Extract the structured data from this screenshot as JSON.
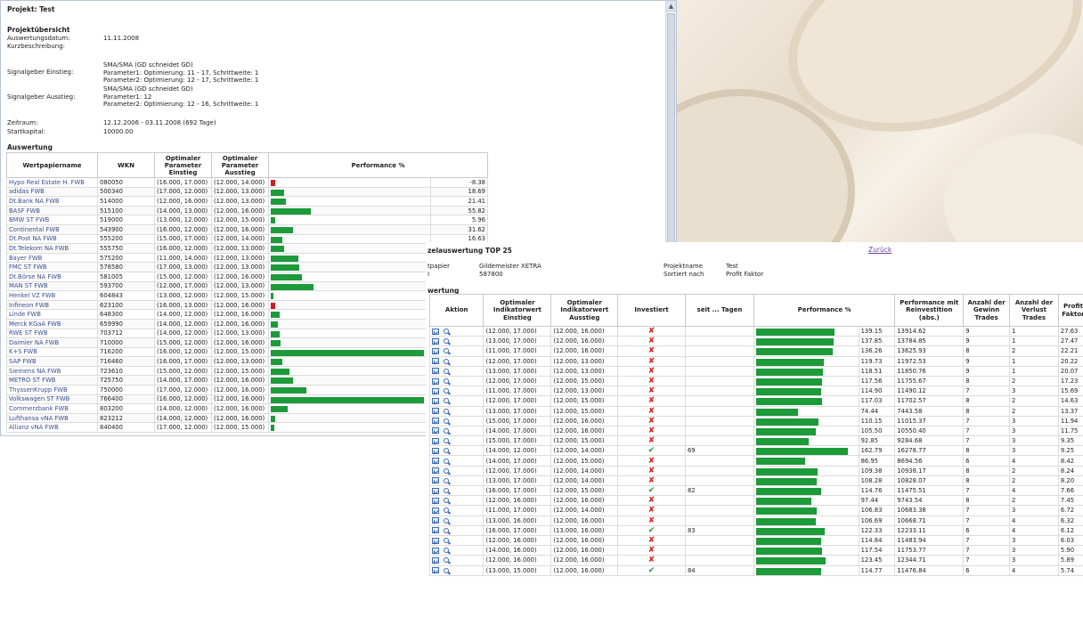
{
  "window1": {
    "title": "Projekt: Test",
    "overview_heading": "Projektübersicht",
    "fields": [
      {
        "label": "Auswertungsdatum:",
        "value": [
          "11.11.2008"
        ]
      },
      {
        "label": "Kurzbeschreibung:",
        "value": [
          ""
        ]
      },
      {
        "label": "Signalgeber Einstieg:",
        "value": [
          "SMA/SMA (GD schneidet GD)",
          "Parameter1: Optimierung: 11 - 17, Schrittweite: 1",
          "Parameter2: Optimierung: 12 - 17, Schrittweite: 1"
        ]
      },
      {
        "label": "Signalgeber Ausstieg:",
        "value": [
          "SMA/SMA (GD schneidet GD)",
          "Parameter1: 12",
          "Parameter2: Optimierung: 12 - 16, Schrittweite: 1"
        ]
      },
      {
        "label": "Zeitraum:",
        "value": [
          "12.12.2006 - 03.11.2008 (692 Tage)"
        ]
      },
      {
        "label": "Startkapital:",
        "value": [
          "10000.00"
        ]
      }
    ],
    "eval_heading": "Auswertung",
    "headers": [
      "Wertpapiername",
      "WKN",
      "Optimaler Parameter Einstieg",
      "Optimaler Parameter Ausstieg",
      "Performance %"
    ],
    "rows": [
      {
        "name": "Hypo Real Estate H. FWB",
        "wkn": "080050",
        "p1": "(16.000, 17.000)",
        "p2": "(12.000, 14.000)",
        "perf": "-8.38",
        "v": -8.38
      },
      {
        "name": "adidas FWB",
        "wkn": "500340",
        "p1": "(17.000, 12.000)",
        "p2": "(12.000, 13.000)",
        "perf": "18.69",
        "v": 18.69
      },
      {
        "name": "Dt.Bank NA FWB",
        "wkn": "514000",
        "p1": "(12.000, 16.000)",
        "p2": "(12.000, 13.000)",
        "perf": "21.41",
        "v": 21.41
      },
      {
        "name": "BASF FWB",
        "wkn": "515100",
        "p1": "(14.000, 13.000)",
        "p2": "(12.000, 16.000)",
        "perf": "55.82",
        "v": 55.82
      },
      {
        "name": "BMW ST FWB",
        "wkn": "519000",
        "p1": "(13.000, 12.000)",
        "p2": "(12.000, 15.000)",
        "perf": "5.96",
        "v": 5.96
      },
      {
        "name": "Continental FWB",
        "wkn": "543900",
        "p1": "(16.000, 12.000)",
        "p2": "(12.000, 16.000)",
        "perf": "31.62",
        "v": 31.62
      },
      {
        "name": "Dt.Post NA FWB",
        "wkn": "555200",
        "p1": "(15.000, 17.000)",
        "p2": "(12.000, 14.000)",
        "perf": "16.63",
        "v": 16.63
      },
      {
        "name": "Dt.Telekom NA FWB",
        "wkn": "555750",
        "p1": "(16.000, 12.000)",
        "p2": "(12.000, 13.000)",
        "perf": "",
        "v": 18.5
      },
      {
        "name": "Bayer FWB",
        "wkn": "575200",
        "p1": "(11.000, 14.000)",
        "p2": "(12.000, 13.000)",
        "perf": "",
        "v": 39.0
      },
      {
        "name": "FMC ST FWB",
        "wkn": "578580",
        "p1": "(17.000, 13.000)",
        "p2": "(12.000, 13.000)",
        "perf": "",
        "v": 40.0
      },
      {
        "name": "Dt.Börse NA FWB",
        "wkn": "581005",
        "p1": "(15.000, 12.000)",
        "p2": "(12.000, 16.000)",
        "perf": "",
        "v": 43.0
      },
      {
        "name": "MAN ST FWB",
        "wkn": "593700",
        "p1": "(12.000, 17.000)",
        "p2": "(12.000, 13.000)",
        "perf": "",
        "v": 60.0
      },
      {
        "name": "Henkel VZ FWB",
        "wkn": "604843",
        "p1": "(13.000, 12.000)",
        "p2": "(12.000, 15.000)",
        "perf": "",
        "v": 4.0
      },
      {
        "name": "Infineon FWB",
        "wkn": "623100",
        "p1": "(16.000, 13.000)",
        "p2": "(12.000, 16.000)",
        "perf": "",
        "v": -8.0
      },
      {
        "name": "Linde FWB",
        "wkn": "648300",
        "p1": "(14.000, 12.000)",
        "p2": "(12.000, 16.000)",
        "perf": "",
        "v": 13.0
      },
      {
        "name": "Merck KGaA FWB",
        "wkn": "659990",
        "p1": "(14.000, 12.000)",
        "p2": "(12.000, 16.000)",
        "perf": "",
        "v": 10.0
      },
      {
        "name": "RWE ST FWB",
        "wkn": "703712",
        "p1": "(14.000, 12.000)",
        "p2": "(12.000, 13.000)",
        "perf": "",
        "v": 13.0
      },
      {
        "name": "Daimler NA FWB",
        "wkn": "710000",
        "p1": "(15.000, 12.000)",
        "p2": "(12.000, 16.000)",
        "perf": "",
        "v": 14.0
      },
      {
        "name": "K+S FWB",
        "wkn": "716200",
        "p1": "(16.000, 12.000)",
        "p2": "(12.000, 15.000)",
        "perf": "",
        "v": 200.0
      },
      {
        "name": "SAP FWB",
        "wkn": "716460",
        "p1": "(16.000, 17.000)",
        "p2": "(12.000, 13.000)",
        "perf": "",
        "v": 16.0
      },
      {
        "name": "Siemens NA FWB",
        "wkn": "723610",
        "p1": "(15.000, 12.000)",
        "p2": "(12.000, 15.000)",
        "perf": "",
        "v": 26.0
      },
      {
        "name": "METRO ST FWB",
        "wkn": "725750",
        "p1": "(14.000, 17.000)",
        "p2": "(12.000, 16.000)",
        "perf": "",
        "v": 31.0
      },
      {
        "name": "ThyssenKrupp FWB",
        "wkn": "750000",
        "p1": "(17.000, 12.000)",
        "p2": "(12.000, 16.000)",
        "perf": "",
        "v": 49.0
      },
      {
        "name": "Volkswagen ST FWB",
        "wkn": "766400",
        "p1": "(16.000, 12.000)",
        "p2": "(12.000, 16.000)",
        "perf": "",
        "v": 200.0
      },
      {
        "name": "Commerzbank FWB",
        "wkn": "803200",
        "p1": "(14.000, 12.000)",
        "p2": "(12.000, 16.000)",
        "perf": "",
        "v": 23.0
      },
      {
        "name": "Lufthansa vNA FWB",
        "wkn": "823212",
        "p1": "(14.000, 12.000)",
        "p2": "(12.000, 16.000)",
        "perf": "",
        "v": 6.0
      },
      {
        "name": "Allianz vNA FWB",
        "wkn": "840400",
        "p1": "(17.000, 12.000)",
        "p2": "(12.000, 15.000)",
        "perf": "",
        "v": 5.0
      }
    ],
    "colors": {
      "positive": "#1d9a3a",
      "negative": "#cc1f1f"
    }
  },
  "window2": {
    "title": "zelauswertung TOP 25",
    "back_link": "Zurück",
    "info": {
      "wp_label": "tpapier",
      "wp_value": "Gildemeister XETRA",
      "wkn_label": "I",
      "wkn_value": "587800",
      "proj_label": "Projektname",
      "proj_value": "Test",
      "sort_label": "Sortiert nach",
      "sort_value": "Profit Faktor"
    },
    "eval_heading": "wertung",
    "headers": [
      "Aktion",
      "Optimaler Indikatorwert Einstieg",
      "Optimaler Indikatorwert Ausstieg",
      "Investiert",
      "seit ... Tagen",
      "Performance %",
      "Performance mit Reinvestition (abs.)",
      "Anzahl der Gewinn Trades",
      "Anzahl der Verlust Trades",
      "Profit Faktor"
    ],
    "rows": [
      {
        "e": "(12.000, 17.000)",
        "a": "(12.000, 16.000)",
        "inv": false,
        "days": "",
        "perf": "139.15",
        "abs": "13914.62",
        "g": "9",
        "l": "1",
        "pf": "27.63"
      },
      {
        "e": "(13.000, 17.000)",
        "a": "(12.000, 16.000)",
        "inv": false,
        "days": "",
        "perf": "137.85",
        "abs": "13784.85",
        "g": "9",
        "l": "1",
        "pf": "27.47"
      },
      {
        "e": "(11.000, 17.000)",
        "a": "(12.000, 16.000)",
        "inv": false,
        "days": "",
        "perf": "136.26",
        "abs": "13625.93",
        "g": "8",
        "l": "2",
        "pf": "22.21"
      },
      {
        "e": "(12.000, 17.000)",
        "a": "(12.000, 13.000)",
        "inv": false,
        "days": "",
        "perf": "119.73",
        "abs": "11972.53",
        "g": "9",
        "l": "1",
        "pf": "20.22"
      },
      {
        "e": "(13.000, 17.000)",
        "a": "(12.000, 13.000)",
        "inv": false,
        "days": "",
        "perf": "118.51",
        "abs": "11850.76",
        "g": "9",
        "l": "1",
        "pf": "20.07"
      },
      {
        "e": "(12.000, 17.000)",
        "a": "(12.000, 15.000)",
        "inv": false,
        "days": "",
        "perf": "117.56",
        "abs": "11755.67",
        "g": "8",
        "l": "2",
        "pf": "17.23"
      },
      {
        "e": "(11.000, 17.000)",
        "a": "(12.000, 13.000)",
        "inv": false,
        "days": "",
        "perf": "114.90",
        "abs": "11490.12",
        "g": "7",
        "l": "3",
        "pf": "15.69"
      },
      {
        "e": "(12.000, 17.000)",
        "a": "(12.000, 15.000)",
        "inv": false,
        "days": "",
        "perf": "117.03",
        "abs": "11702.57",
        "g": "8",
        "l": "2",
        "pf": "14.63"
      },
      {
        "e": "(13.000, 17.000)",
        "a": "(12.000, 15.000)",
        "inv": false,
        "days": "",
        "perf": "74.44",
        "abs": "7443.58",
        "g": "8",
        "l": "2",
        "pf": "13.37"
      },
      {
        "e": "(15.000, 17.000)",
        "a": "(12.000, 16.000)",
        "inv": false,
        "days": "",
        "perf": "110.15",
        "abs": "11015.37",
        "g": "7",
        "l": "3",
        "pf": "11.94"
      },
      {
        "e": "(14.000, 17.000)",
        "a": "(12.000, 16.000)",
        "inv": false,
        "days": "",
        "perf": "105.50",
        "abs": "10550.40",
        "g": "7",
        "l": "3",
        "pf": "11.75"
      },
      {
        "e": "(15.000, 17.000)",
        "a": "(12.000, 15.000)",
        "inv": false,
        "days": "",
        "perf": "92.85",
        "abs": "9284.68",
        "g": "7",
        "l": "3",
        "pf": "9.35"
      },
      {
        "e": "(14.000, 12.000)",
        "a": "(12.000, 14.000)",
        "inv": true,
        "days": "69",
        "perf": "162.79",
        "abs": "16278.77",
        "g": "8",
        "l": "3",
        "pf": "9.25"
      },
      {
        "e": "(14.000, 17.000)",
        "a": "(12.000, 15.000)",
        "inv": false,
        "days": "",
        "perf": "86.95",
        "abs": "8694.56",
        "g": "6",
        "l": "4",
        "pf": "8.42"
      },
      {
        "e": "(12.000, 17.000)",
        "a": "(12.000, 14.000)",
        "inv": false,
        "days": "",
        "perf": "109.38",
        "abs": "10938.17",
        "g": "8",
        "l": "2",
        "pf": "8.24"
      },
      {
        "e": "(13.000, 17.000)",
        "a": "(12.000, 14.000)",
        "inv": false,
        "days": "",
        "perf": "108.28",
        "abs": "10828.07",
        "g": "8",
        "l": "2",
        "pf": "8.20"
      },
      {
        "e": "(16.000, 17.000)",
        "a": "(12.000, 15.000)",
        "inv": true,
        "days": "82",
        "perf": "114.76",
        "abs": "11475.51",
        "g": "7",
        "l": "4",
        "pf": "7.66"
      },
      {
        "e": "(12.000, 16.000)",
        "a": "(12.000, 16.000)",
        "inv": false,
        "days": "",
        "perf": "97.44",
        "abs": "9743.54",
        "g": "8",
        "l": "2",
        "pf": "7.45"
      },
      {
        "e": "(11.000, 17.000)",
        "a": "(12.000, 14.000)",
        "inv": false,
        "days": "",
        "perf": "106.83",
        "abs": "10683.38",
        "g": "7",
        "l": "3",
        "pf": "6.72"
      },
      {
        "e": "(13.000, 16.000)",
        "a": "(12.000, 16.000)",
        "inv": false,
        "days": "",
        "perf": "106.69",
        "abs": "10668.71",
        "g": "7",
        "l": "4",
        "pf": "6.32"
      },
      {
        "e": "(16.000, 17.000)",
        "a": "(13.000, 16.000)",
        "inv": true,
        "days": "83",
        "perf": "122.33",
        "abs": "12233.11",
        "g": "6",
        "l": "4",
        "pf": "6.12"
      },
      {
        "e": "(12.000, 16.000)",
        "a": "(12.000, 16.000)",
        "inv": false,
        "days": "",
        "perf": "114.84",
        "abs": "11483.94",
        "g": "7",
        "l": "3",
        "pf": "6.03"
      },
      {
        "e": "(14.000, 16.000)",
        "a": "(12.000, 16.000)",
        "inv": false,
        "days": "",
        "perf": "117.54",
        "abs": "11753.77",
        "g": "7",
        "l": "3",
        "pf": "5.90"
      },
      {
        "e": "(12.000, 16.000)",
        "a": "(12.000, 16.000)",
        "inv": false,
        "days": "",
        "perf": "123.45",
        "abs": "12344.71",
        "g": "7",
        "l": "3",
        "pf": "5.89"
      },
      {
        "e": "(13.000, 15.000)",
        "a": "(12.000, 16.000)",
        "inv": true,
        "days": "84",
        "perf": "114.77",
        "abs": "11476.84",
        "g": "6",
        "l": "4",
        "pf": "5.74"
      }
    ]
  }
}
